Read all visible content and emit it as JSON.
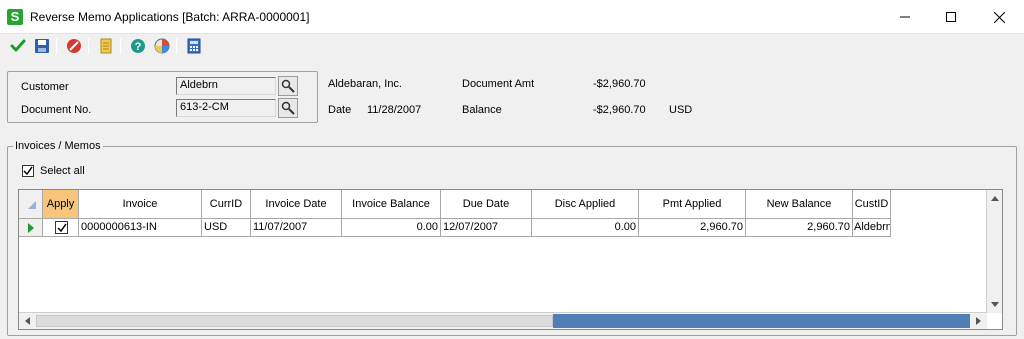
{
  "window": {
    "title": "Reverse Memo Applications [Batch: ARRA-0000001]",
    "app_icon_letter": "S"
  },
  "toolbar": {
    "buttons": [
      "checkmark-icon",
      "save-icon",
      "cancel-icon",
      "notes-icon",
      "help-icon",
      "web-icon",
      "calculator-icon"
    ]
  },
  "header": {
    "customer_label": "Customer",
    "customer_value": "Aldebrn",
    "document_label": "Document No.",
    "document_value": "613-2-CM",
    "customer_name": "Aldebaran, Inc.",
    "date_label": "Date",
    "date_value": "11/28/2007",
    "doc_amt_label": "Document Amt",
    "doc_amt_value": "-$2,960.70",
    "balance_label": "Balance",
    "balance_value": "-$2,960.70",
    "currency": "USD"
  },
  "invoices": {
    "group_label": "Invoices / Memos",
    "select_all_label": "Select all",
    "select_all_checked": true,
    "columns": [
      "Apply",
      "Invoice",
      "CurrID",
      "Invoice Date",
      "Invoice Balance",
      "Due Date",
      "Disc Applied",
      "Pmt Applied",
      "New Balance",
      "CustID"
    ],
    "rows": [
      {
        "apply": true,
        "invoice": "0000000613-IN",
        "curr_id": "USD",
        "invoice_date": "11/07/2007",
        "invoice_balance": "0.00",
        "due_date": "12/07/2007",
        "disc_applied": "0.00",
        "pmt_applied": "2,960.70",
        "new_balance": "2,960.70",
        "cust_id": "Aldebrn"
      }
    ]
  },
  "colors": {
    "apply_header": "#f7c67c",
    "accent_green": "#27a332",
    "scroll_thumb": "#4f7fb6"
  }
}
